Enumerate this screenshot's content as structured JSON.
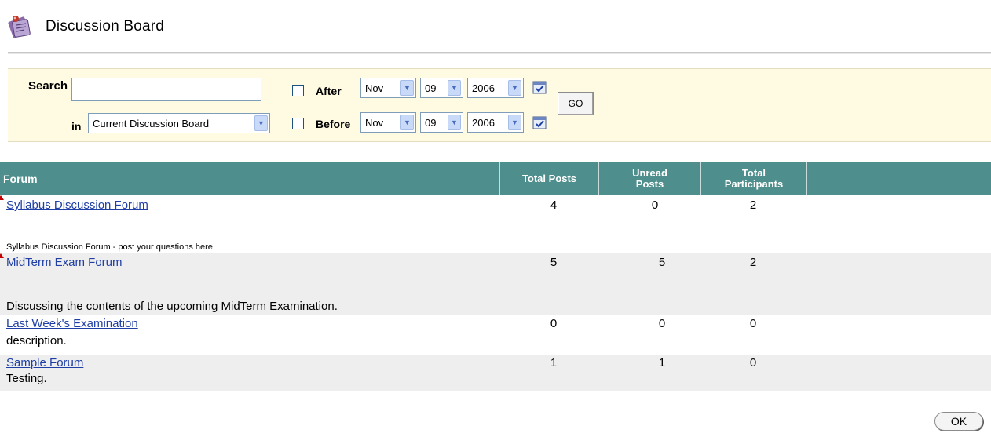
{
  "page": {
    "title": "Discussion Board"
  },
  "search": {
    "label": "Search",
    "in_label": "in",
    "value": "",
    "scope_selected": "Current Discussion Board",
    "after_label": "After",
    "before_label": "Before",
    "after": {
      "month": "Nov",
      "day": "09",
      "year": "2006",
      "checked": false
    },
    "before": {
      "month": "Nov",
      "day": "09",
      "year": "2006",
      "checked": false
    },
    "go_label": "GO"
  },
  "table": {
    "headers": {
      "forum": "Forum",
      "total_posts": "Total Posts",
      "unread_posts": "Unread Posts",
      "total_participants": "Total Participants"
    },
    "rows": [
      {
        "title": "Syllabus Discussion Forum",
        "description": "Syllabus Discussion Forum - post your questions here",
        "total_posts": "4",
        "unread_posts": "0",
        "total_participants": "2"
      },
      {
        "title": "MidTerm Exam Forum",
        "description": "Discussing the contents of the upcoming MidTerm Examination.",
        "total_posts": "5",
        "unread_posts": "5",
        "total_participants": "2"
      },
      {
        "title": "Last Week's Examination",
        "description": "description.",
        "total_posts": "0",
        "unread_posts": "0",
        "total_participants": "0"
      },
      {
        "title": "Sample Forum",
        "description": "Testing.",
        "total_posts": "1",
        "unread_posts": "1",
        "total_participants": "0"
      }
    ]
  },
  "footer": {
    "ok_label": "OK"
  },
  "colors": {
    "header_bg": "#4e8e8c",
    "panel_bg": "#fffbe3",
    "link": "#1f3fa6",
    "row_shade": "#eeeeee"
  },
  "icons": {
    "board": "discussion-board-icon",
    "calendar": "calendar-icon",
    "dropdown": "chevron-down-icon"
  }
}
